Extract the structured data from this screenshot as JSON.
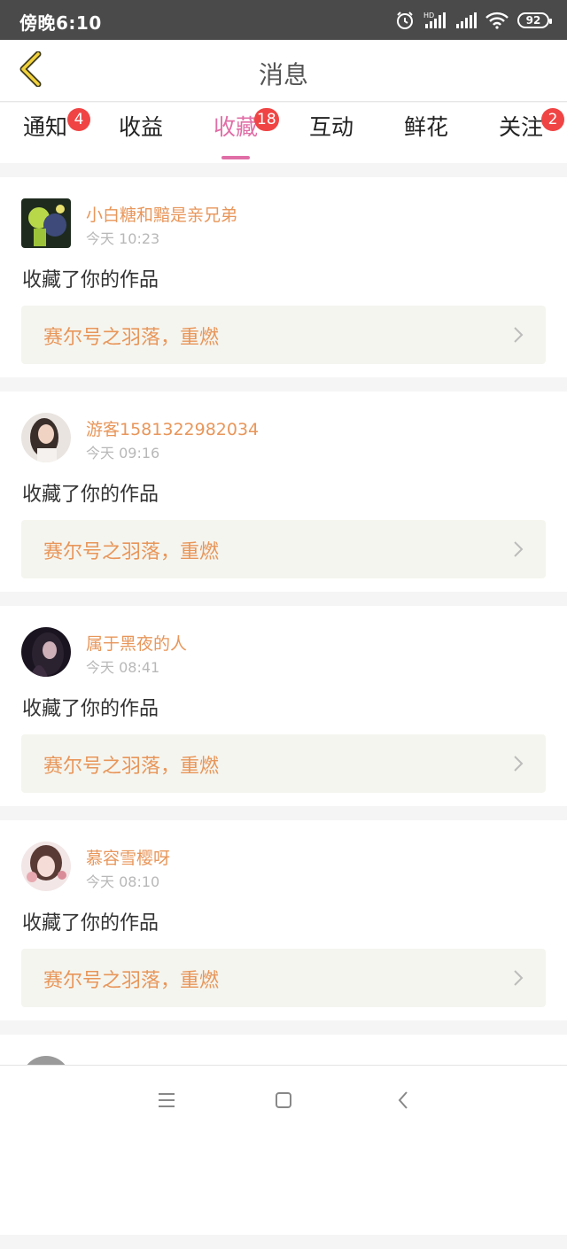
{
  "status_bar": {
    "time": "傍晚6:10",
    "battery": "92",
    "icons": [
      "alarm-icon",
      "hd-signal-icon",
      "signal-icon",
      "wifi-icon",
      "battery-icon"
    ]
  },
  "header": {
    "title": "消息",
    "back_icon": "chevron-left-icon"
  },
  "tabs": [
    {
      "label": "通知",
      "badge": "4",
      "active": false
    },
    {
      "label": "收益",
      "badge": "",
      "active": false
    },
    {
      "label": "收藏",
      "badge": "18",
      "active": true
    },
    {
      "label": "互动",
      "badge": "",
      "active": false
    },
    {
      "label": "鲜花",
      "badge": "",
      "active": false
    },
    {
      "label": "关注",
      "badge": "2",
      "active": false
    }
  ],
  "feed": [
    {
      "username": "小白糖和黯是亲兄弟",
      "time": "今天 10:23",
      "message": "收藏了你的作品",
      "work": "赛尔号之羽落，重燃"
    },
    {
      "username": "游客1581322982034",
      "time": "今天 09:16",
      "message": "收藏了你的作品",
      "work": "赛尔号之羽落，重燃"
    },
    {
      "username": "属于黑夜的人",
      "time": "今天 08:41",
      "message": "收藏了你的作品",
      "work": "赛尔号之羽落，重燃"
    },
    {
      "username": "慕容雪樱呀",
      "time": "今天 08:10",
      "message": "收藏了你的作品",
      "work": "赛尔号之羽落，重燃"
    }
  ],
  "colors": {
    "accent_pink": "#e06ea6",
    "username_orange": "#e8965a",
    "badge_red": "#f04444"
  },
  "bottom_nav": [
    "menu-icon",
    "home-icon",
    "back-icon"
  ]
}
